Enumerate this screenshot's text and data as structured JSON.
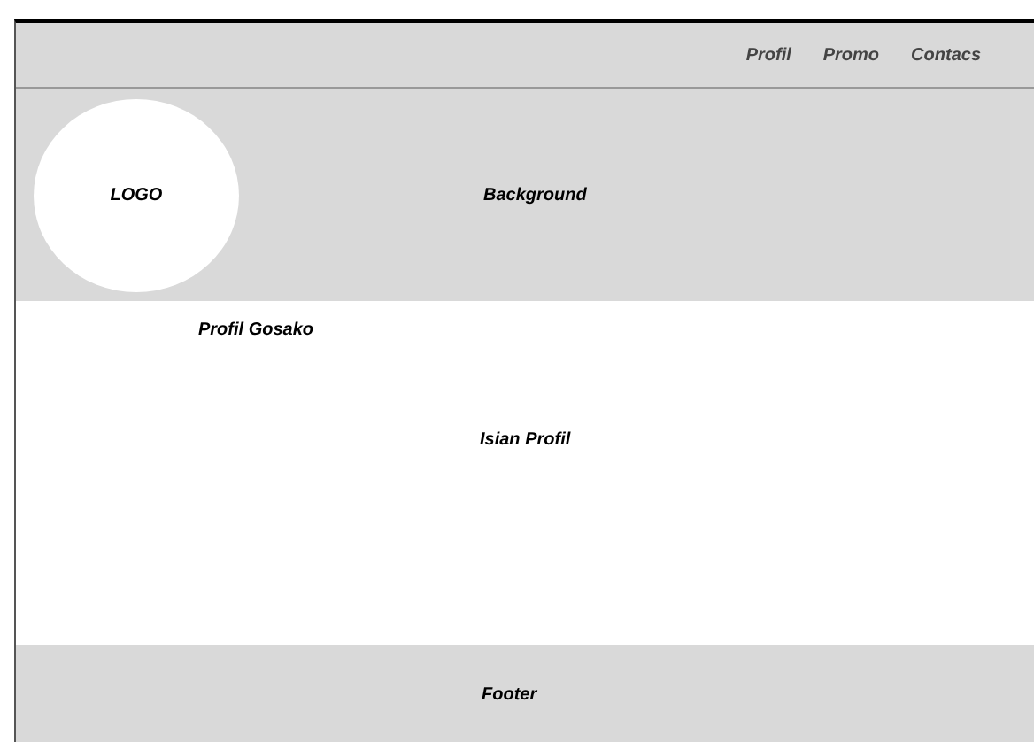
{
  "nav": {
    "links": [
      {
        "label": "Profil"
      },
      {
        "label": "Promo"
      },
      {
        "label": "Contacs"
      }
    ]
  },
  "header": {
    "logo": "LOGO",
    "background": "Background"
  },
  "main": {
    "title": "Profil Gosako",
    "content": "Isian Profil"
  },
  "footer": {
    "text": "Footer"
  }
}
